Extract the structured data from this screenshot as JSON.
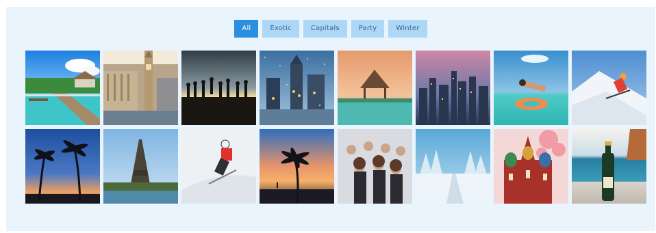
{
  "filters": {
    "items": [
      {
        "label": "All",
        "active": true
      },
      {
        "label": "Exotic",
        "active": false
      },
      {
        "label": "Capitals",
        "active": false
      },
      {
        "label": "Party",
        "active": false
      },
      {
        "label": "Winter",
        "active": false
      }
    ]
  },
  "colors": {
    "panel_bg": "#eaf4fd",
    "active_button": "#2b8fe0",
    "inactive_button": "#aed6f5"
  },
  "gallery": {
    "photos": [
      {
        "subject": "tropical-resort-pool"
      },
      {
        "subject": "london-westminster"
      },
      {
        "subject": "sunset-jumping-crowd"
      },
      {
        "subject": "snowy-city-night"
      },
      {
        "subject": "infinity-pool-gazebo"
      },
      {
        "subject": "city-skyline-dusk"
      },
      {
        "subject": "woman-on-float"
      },
      {
        "subject": "skier-downhill"
      },
      {
        "subject": "palm-trees-sunset"
      },
      {
        "subject": "eiffel-tower"
      },
      {
        "subject": "skier-red-jacket"
      },
      {
        "subject": "palm-beach-sunset"
      },
      {
        "subject": "party-crowd"
      },
      {
        "subject": "snowy-forest-road"
      },
      {
        "subject": "st-basils-cathedral"
      },
      {
        "subject": "champagne-bottle-sea"
      }
    ]
  }
}
